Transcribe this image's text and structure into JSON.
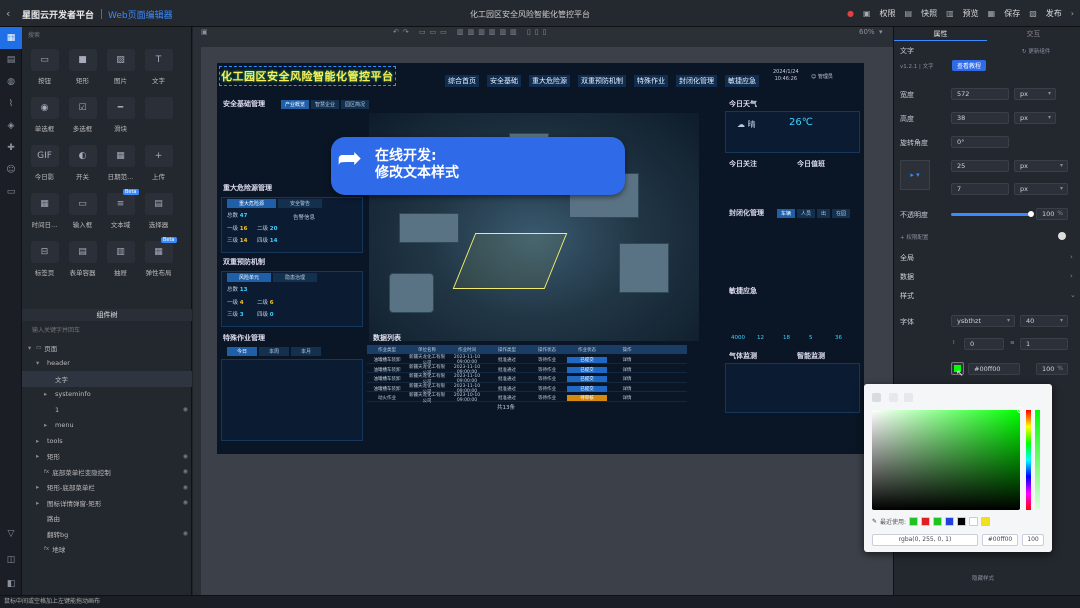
{
  "topbar": {
    "brand": "星图云开发者平台",
    "editor": "Web页面编辑器",
    "page_title": "化工园区安全风险智能化管控平台",
    "actions": [
      "权限",
      "快照",
      "预览",
      "保存",
      "发布"
    ]
  },
  "left_panel": {
    "search_placeholder": "搜索",
    "components": [
      {
        "label": "按钮",
        "icon": "button-icon",
        "glyph": "▭"
      },
      {
        "label": "矩形",
        "icon": "rectangle-icon",
        "glyph": "■"
      },
      {
        "label": "图片",
        "icon": "image-icon",
        "glyph": "▨"
      },
      {
        "label": "文字",
        "icon": "text-icon",
        "glyph": "T"
      },
      {
        "label": "单选框",
        "icon": "radio-icon",
        "glyph": "◉"
      },
      {
        "label": "多选框",
        "icon": "checkbox-icon",
        "glyph": "☑"
      },
      {
        "label": "滑块",
        "icon": "slider-icon",
        "glyph": "━"
      },
      {
        "label": "",
        "icon": "hidden-icon",
        "glyph": ""
      },
      {
        "label": "今日影",
        "icon": "gif-icon",
        "glyph": "GIF"
      },
      {
        "label": "开关",
        "icon": "switch-icon",
        "glyph": "◐"
      },
      {
        "label": "日期范...",
        "icon": "date-range-icon",
        "glyph": "▦"
      },
      {
        "label": "上传",
        "icon": "upload-icon",
        "glyph": "+"
      },
      {
        "label": "时间日...",
        "icon": "datetime-icon",
        "glyph": "▦"
      },
      {
        "label": "输入框",
        "icon": "input-icon",
        "glyph": "▭"
      },
      {
        "label": "文本域",
        "icon": "textarea-icon",
        "glyph": "≡",
        "beta": "Beta"
      },
      {
        "label": "选择器",
        "icon": "select-icon",
        "glyph": "▤"
      },
      {
        "label": "标签页",
        "icon": "tabs-icon",
        "glyph": "⊟"
      },
      {
        "label": "表单容器",
        "icon": "form-icon",
        "glyph": "▤"
      },
      {
        "label": "抽屉",
        "icon": "drawer-icon",
        "glyph": "▥"
      },
      {
        "label": "弹性布局",
        "icon": "flex-icon",
        "glyph": "▦",
        "beta": "Beta"
      }
    ],
    "tree_tab": "组件树",
    "tree_search": "输入关键字并回车",
    "tree": [
      {
        "label": "页面",
        "indent": 0,
        "arrow": "▾",
        "icon": "▭"
      },
      {
        "label": "header",
        "indent": 1,
        "arrow": "▾",
        "icon": ""
      },
      {
        "label": "文字",
        "indent": 2,
        "arrow": "",
        "icon": "",
        "selected": true
      },
      {
        "label": "systeminfo",
        "indent": 2,
        "arrow": "▸",
        "icon": ""
      },
      {
        "label": "1",
        "indent": 2,
        "arrow": "",
        "icon": "",
        "eye": true
      },
      {
        "label": "menu",
        "indent": 2,
        "arrow": "▸",
        "icon": ""
      },
      {
        "label": "tools",
        "indent": 1,
        "arrow": "▸",
        "icon": ""
      },
      {
        "label": "矩形",
        "indent": 1,
        "arrow": "▸",
        "icon": "",
        "eye": true
      },
      {
        "label": "底部菜单栏变隐控制",
        "indent": 1,
        "arrow": "",
        "icon": "fx",
        "eye": true
      },
      {
        "label": "矩形-底部菜单栏",
        "indent": 1,
        "arrow": "▸",
        "icon": "",
        "eye": true
      },
      {
        "label": "图标详情弹窗-矩形",
        "indent": 1,
        "arrow": "▸",
        "icon": "",
        "eye": true
      },
      {
        "label": "路由",
        "indent": 1,
        "arrow": "",
        "icon": ""
      },
      {
        "label": "翻转bg",
        "indent": 1,
        "arrow": "",
        "icon": "",
        "eye": true
      },
      {
        "label": "地球",
        "indent": 1,
        "arrow": "",
        "icon": "fx"
      }
    ]
  },
  "canvas": {
    "zoom": "60%",
    "board": {
      "title": "化工园区安全风险智能化管控平台",
      "nav": [
        "综合首页",
        "安全基础",
        "重大危险源",
        "双重预防机制",
        "特殊作业",
        "封闭化管理",
        "敏捷应急"
      ],
      "date": "2024/1/24",
      "time": "10:46:26",
      "manager": "管理员",
      "safety_title": "安全基础管理",
      "safety_tabs": [
        "产业概览",
        "智慧企业",
        "园区简况"
      ],
      "hazard_title": "重大危险源管理",
      "hazard_tabs": [
        "重大危险源",
        "安全警告"
      ],
      "hazard_stats": [
        {
          "k": "总数",
          "v": "47",
          "color": "c"
        },
        {
          "k": "一级",
          "v": "16",
          "color": "y"
        },
        {
          "k": "二级",
          "v": "20",
          "color": "c"
        },
        {
          "k": "三级",
          "v": "14",
          "color": "y"
        },
        {
          "k": "四级",
          "v": "14",
          "color": "c"
        }
      ],
      "warn_label": "告警信息",
      "dual_title": "双重预防机制",
      "dual_tabs": [
        "风险单元",
        "隐患治理"
      ],
      "dual_stats": [
        {
          "k": "总数",
          "v": "13",
          "color": "c"
        },
        {
          "k": "一级",
          "v": "4",
          "color": "y"
        },
        {
          "k": "二级",
          "v": "6",
          "color": "y"
        },
        {
          "k": "三级",
          "v": "3",
          "color": "c"
        },
        {
          "k": "四级",
          "v": "0",
          "color": "c"
        }
      ],
      "special_title": "特殊作业管理",
      "special_tabs": [
        "今日",
        "本周",
        "本月"
      ],
      "table_title": "数据列表",
      "table_headers": [
        "作业类型",
        "单位名称",
        "作业时间",
        "操作类型",
        "操作状态",
        "作业状态",
        "操作"
      ],
      "table_rows": [
        {
          "c": [
            "油罐槽车装卸",
            "新疆天龙化工有限公司",
            "2023-11-10 09:00:00",
            "批准通过",
            "等待作业",
            "已提交",
            "详情"
          ],
          "org": false
        },
        {
          "c": [
            "油罐槽车装卸",
            "新疆天龙化工有限公司",
            "2023-11-10 09:00:00",
            "批准通过",
            "等待作业",
            "已提交",
            "详情"
          ],
          "org": false
        },
        {
          "c": [
            "油罐槽车装卸",
            "新疆天龙化工有限公司",
            "2023-11-10 09:00:00",
            "批准通过",
            "等待作业",
            "已提交",
            "详情"
          ],
          "org": false
        },
        {
          "c": [
            "油罐槽车装卸",
            "新疆天龙化工有限公司",
            "2023-11-10 09:00:00",
            "批准通过",
            "等待作业",
            "已提交",
            "详情"
          ],
          "org": false
        },
        {
          "c": [
            "动火作业",
            "新疆天龙化工有限公司",
            "2023-10-10 09:00:00",
            "批准通过",
            "等待作业",
            "待审核",
            "详情"
          ],
          "org": true
        }
      ],
      "pagination": "共13条",
      "weather_title": "今日天气",
      "weather_state": "晴",
      "temp": "26℃",
      "focus_title": "今日关注",
      "duty_title": "今日值班",
      "closed_title": "封闭化管理",
      "closed_tabs": [
        "车辆",
        "人员",
        "出",
        "在园"
      ],
      "emerg_title": "敏捷应急",
      "gas_title": "气体监测",
      "env_title": "智能监测",
      "env_values": [
        "4000",
        "12",
        "18",
        "5",
        "36"
      ]
    }
  },
  "callout": {
    "line1": "在线开发:",
    "line2": "修改文本样式"
  },
  "right_panel": {
    "tabs": [
      "属性",
      "交互"
    ],
    "component": "文字",
    "version": "v1.2.1 | 文字",
    "help": "查看教程",
    "update": "更新组件",
    "width_label": "宽度",
    "width": "572",
    "width_unit": "px",
    "height_label": "高度",
    "height": "38",
    "height_unit": "px",
    "rotate_label": "旋转角度",
    "rotate": "0°",
    "x": "25",
    "x_unit": "px",
    "y": "7",
    "y_unit": "px",
    "opacity_label": "不透明度",
    "opacity": "100",
    "opacity_pct": "%",
    "perm_label": "权限配置",
    "sec_global": "全局",
    "sec_data": "数据",
    "sec_style": "样式",
    "font_label": "字体",
    "font": "ysbthzt",
    "font_size": "40",
    "letter": "0",
    "line": "1",
    "color_label": "颜色",
    "color_hex": "#00ff00",
    "color_alpha": "100",
    "color_alpha_pct": "%",
    "hidden_style": "隐藏样式"
  },
  "color_picker": {
    "recent_label": "最近使用:",
    "recent_colors": [
      "#22c022",
      "#e02020",
      "#1ec41e",
      "#2040e0",
      "#000000",
      "#ffffff",
      "#f0e020"
    ],
    "rgba": "rgba(0, 255, 0, 1)",
    "hex": "#00ff00",
    "alpha": "100"
  },
  "status_bar": "鼠标中间或空格加上左键能拖动画布"
}
